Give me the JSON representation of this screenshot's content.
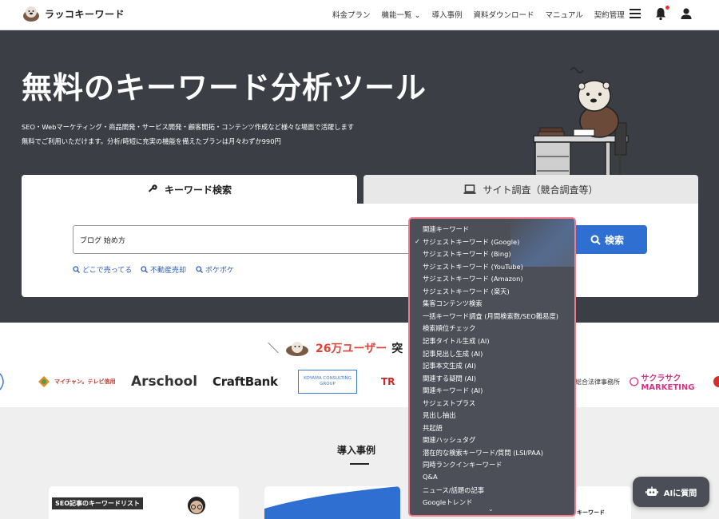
{
  "header": {
    "logo_text": "ラッコキーワード",
    "nav": [
      "料金プラン",
      "機能一覧 ⌄",
      "導入事例",
      "資料ダウンロード",
      "マニュアル",
      "契約管理"
    ],
    "icons": [
      "menu-icon",
      "bell-icon",
      "user-icon"
    ]
  },
  "hero": {
    "title": "無料のキーワード分析ツール",
    "subtitle_1": "SEO・Webマーケティング・商品開発・サービス開発・顧客開拓・コンテンツ作成など様々な場面で活躍します",
    "subtitle_2": "無料でご利用いただけます。分析/時短に充実の機能を備えたプランは月々わずか990円"
  },
  "search": {
    "tab_keyword": "キーワード検索",
    "tab_site": "サイト調査（競合調査等）",
    "input_value": "ブログ 始め方",
    "button_label": "検索",
    "quick_links": [
      "どこで売ってる",
      "不動産売却",
      "ポケポケ"
    ]
  },
  "dropdown": {
    "selected_index": 1,
    "items": [
      "関連キーワード",
      "サジェストキーワード (Google)",
      "サジェストキーワード (Bing)",
      "サジェストキーワード (YouTube)",
      "サジェストキーワード (Amazon)",
      "サジェストキーワード (楽天)",
      "集客コンテンツ検索",
      "一括キーワード調査 (月間検索数/SEO難易度)",
      "検索順位チェック",
      "記事タイトル生成 (AI)",
      "記事見出し生成 (AI)",
      "記事本文生成 (AI)",
      "関連する疑問 (AI)",
      "関連キーワード (AI)",
      "サジェストプラス",
      "見出し抽出",
      "共起語",
      "関連ハッシュタグ",
      "潜在的な検索キーワード/質問 (LSI/PAA)",
      "同時ランクインキーワード",
      "Q&A",
      "ニュース/話題の記事",
      "Googleトレンド"
    ],
    "check_mark": "✓",
    "more_indicator": "⌄"
  },
  "users": {
    "count": "26万ユーザー",
    "suffix": "突"
  },
  "logos": [
    "マイチャン。テレビ信用",
    "Arschool",
    "CraftBank",
    "KOYAMA CONSULTING GROUP",
    "TR",
    "総合法律事務所",
    "サクラサク MARKETING"
  ],
  "cases": {
    "title": "導入事例",
    "card1_label": "SEO記事のキーワードリスト",
    "card2_label": "キーワード"
  },
  "ai_button": {
    "label": "AIに質問"
  }
}
